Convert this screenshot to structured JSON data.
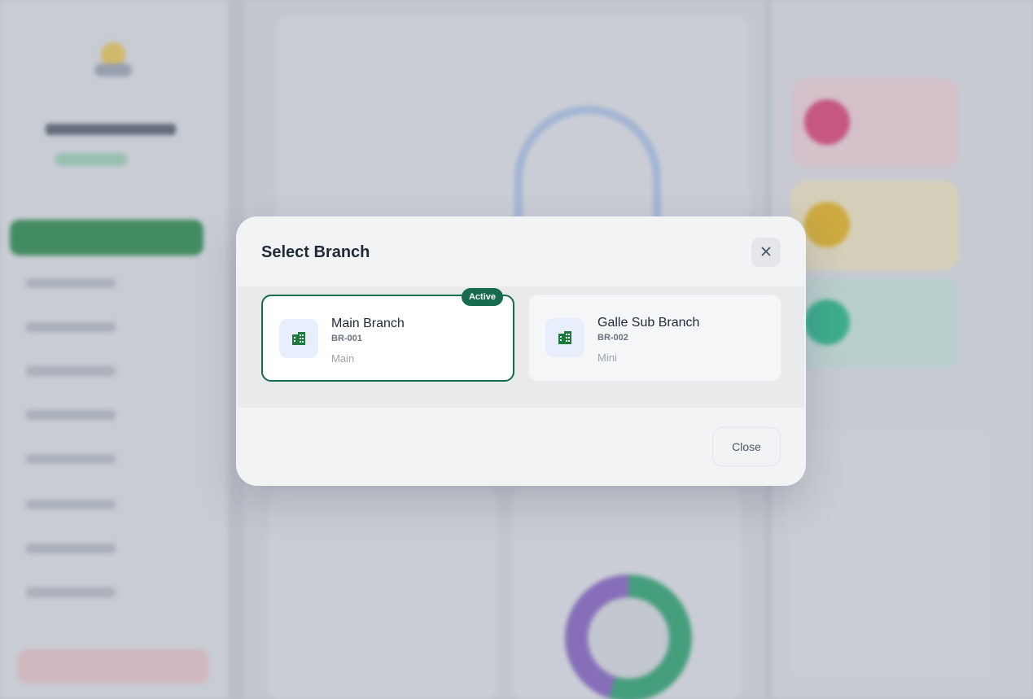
{
  "modal": {
    "title": "Select Branch",
    "close_button_label": "Close",
    "close_icon": "close-icon"
  },
  "branches": [
    {
      "name": "Main Branch",
      "code": "BR-001",
      "type": "Main",
      "badge": "Active",
      "icon": "building-icon",
      "active": true
    },
    {
      "name": "Galle Sub Branch",
      "code": "BR-002",
      "type": "Mini",
      "icon": "building-icon",
      "active": false
    }
  ],
  "colors": {
    "accent": "#176b4d",
    "icon_green": "#1e7a3c",
    "icon_bg": "#e8eefb"
  }
}
